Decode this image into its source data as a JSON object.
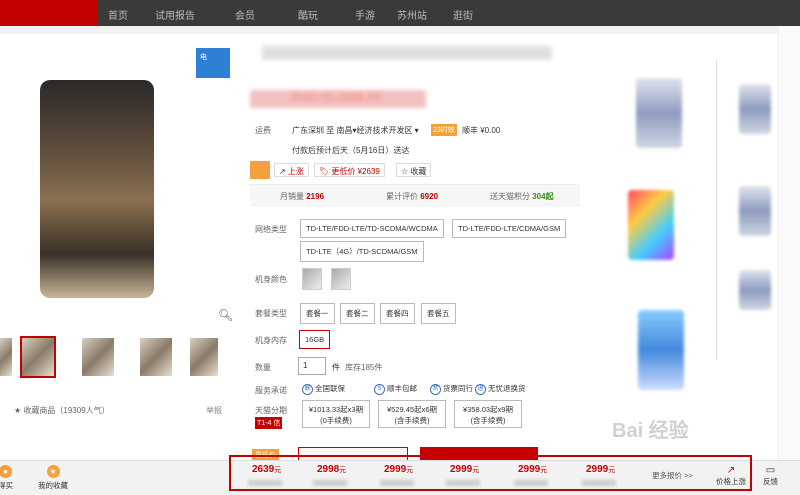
{
  "nav": {
    "items": [
      "首页",
      "试用报告",
      "会员",
      "酷玩",
      "手游",
      "苏州站",
      "逛街"
    ]
  },
  "gallery": {
    "brand_badge": "电",
    "favorite_text": "★ 收藏商品（19309人气）",
    "report_text": "举报",
    "zoom_icon": "magnifier-icon"
  },
  "product": {
    "price_range": "3040.00-3398.00",
    "shipping_label": "运费",
    "shipping_route": "广东深圳 至 南昌▾经济技术开发区 ▾",
    "shipping_tag": "23时效",
    "shipping_fee": "顺丰 ¥0.00",
    "shipping_eta": "付款后预计后天（5月16日）送达",
    "actions": {
      "rise": "↗ 上涨",
      "cheaper": "🏷 更低价 ¥2639",
      "favorite": "☆ 收藏"
    },
    "stats": {
      "monthly_sales_label": "月销量",
      "monthly_sales": "2196",
      "reviews_label": "累计评价",
      "reviews": "6920",
      "points_label": "送天猫积分",
      "points": "304起"
    },
    "network_label": "网络类型",
    "networks": [
      "TD-LTE/FDD-LTE/TD-SCDMA/WCDMA",
      "TD-LTE/FDD-LTE/CDMA/GSM",
      "TD-LTE（4G）/TD-SCDMA/GSM"
    ],
    "color_label": "机身颜色",
    "package_label": "套餐类型",
    "packages": [
      "套餐一",
      "套餐二",
      "套餐四",
      "套餐五"
    ],
    "memory_label": "机身内存",
    "memory_value": "16GB",
    "qty_label": "数量",
    "qty_value": "1",
    "qty_unit": "件",
    "stock": "库存185件",
    "service_label": "服务承诺",
    "services": [
      "全国联保",
      "顺丰包邮",
      "货票同行",
      "无忧退换货"
    ],
    "installment_label": "天猫分期",
    "installment_tag": "T1-4 信",
    "installments": [
      {
        "amount": "¥1013.33起x3期",
        "note": "(0手续费)"
      },
      {
        "amount": "¥529.45起x6期",
        "note": "(含手续费)"
      },
      {
        "amount": "¥358.03起x9期",
        "note": "(含手续费)"
      }
    ],
    "buy_tag": "更低价"
  },
  "bottom": {
    "left_items": [
      {
        "icon": "store-icon",
        "label": "得买"
      },
      {
        "icon": "star-icon",
        "label": "我的收藏"
      }
    ],
    "prices": [
      "2639",
      "2998",
      "2999",
      "2999",
      "2999",
      "2999"
    ],
    "price_unit": "元",
    "more_label": "更多报价 >>",
    "price_up_label": "价格上涨",
    "feedback_label": "反馈"
  },
  "watermark": "Bai 经验"
}
